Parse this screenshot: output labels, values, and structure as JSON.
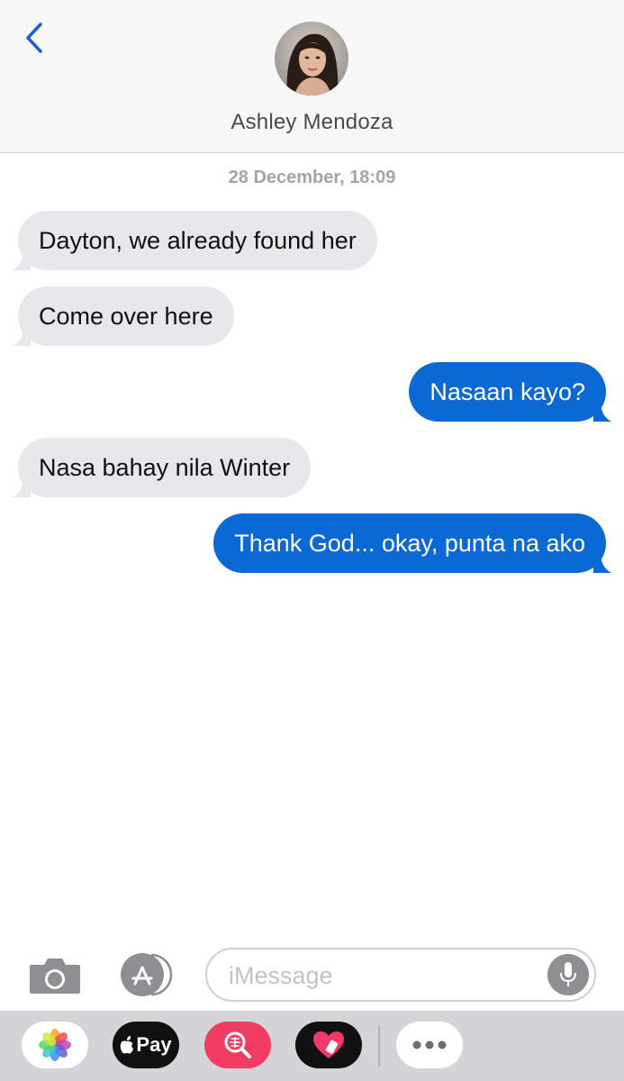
{
  "header": {
    "contact_name": "Ashley Mendoza"
  },
  "conversation": {
    "timestamp": "28 December, 18:09",
    "messages": [
      {
        "direction": "incoming",
        "text": "Dayton, we already found her"
      },
      {
        "direction": "incoming",
        "text": "Come over here"
      },
      {
        "direction": "outgoing",
        "text": "Nasaan kayo?"
      },
      {
        "direction": "incoming",
        "text": "Nasa bahay nila Winter"
      },
      {
        "direction": "outgoing",
        "text": "Thank God... okay, punta na ako"
      }
    ]
  },
  "composer": {
    "placeholder": "iMessage",
    "value": ""
  },
  "app_drawer": {
    "apple_pay_label": "Pay",
    "apps": [
      "photos-icon",
      "apple-pay-icon",
      "image-search-icon",
      "digital-touch-icon",
      "more-icon"
    ]
  },
  "colors": {
    "accent": "#0a69d4",
    "incoming_bubble": "#e6e6eb",
    "back_chevron": "#1a5fd6"
  }
}
